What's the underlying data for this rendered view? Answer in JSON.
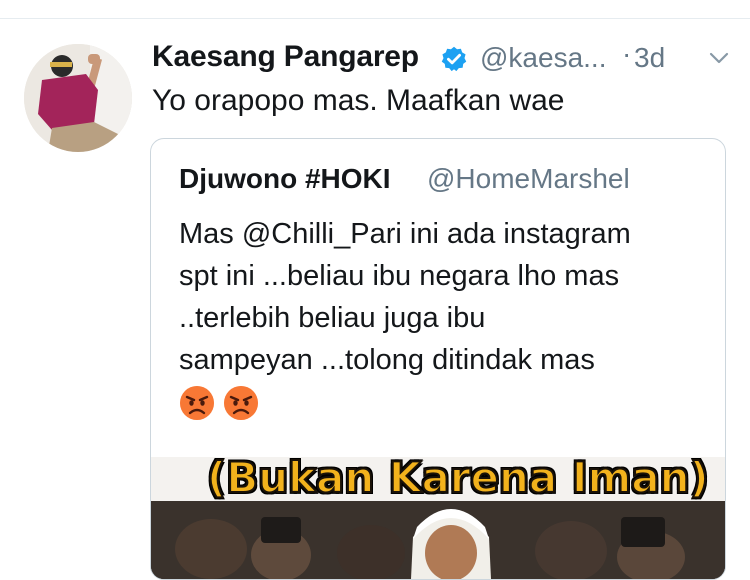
{
  "tweet": {
    "display_name": "Kaesang Pangarep",
    "handle": "@kaesa...",
    "separator": "·",
    "time": "3d",
    "text": "Yo orapopo mas. Maafkan wae"
  },
  "quoted_tweet": {
    "display_name": "Djuwono #HOKI",
    "handle": "@HomeMarshel",
    "lines": [
      "Mas @Chilli_Pari ini ada instagram",
      "spt ini ...beliau ibu negara lho mas",
      "..terlebih beliau juga ibu",
      "sampeyan ...tolong ditindak mas"
    ],
    "emojis": [
      "angry-face-icon",
      "angry-face-icon"
    ],
    "media_caption": "(Bukan Karena Iman)"
  },
  "colors": {
    "text": "#14171a",
    "secondary": "#657786",
    "verified": "#1da1f2",
    "border": "#ccd6dd",
    "caption": "#f2b21c"
  }
}
